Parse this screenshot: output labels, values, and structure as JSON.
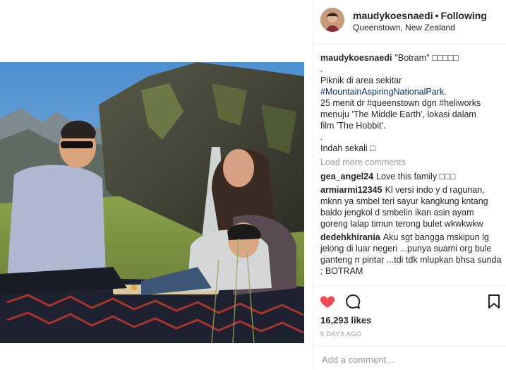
{
  "header": {
    "username": "maudykoesnaedi",
    "separator": "•",
    "follow_status": "Following",
    "location": "Queenstown, New Zealand"
  },
  "caption": {
    "username": "maudykoesnaedi",
    "lines": [
      "\"Botram\" □□□□□",
      ".",
      "Piknik di area sekitar",
      "#MountainAspiringNationalPark.",
      "25 menit dr #queenstown dgn #heliworks",
      "menuju 'The Middle Earth', lokasi dalam",
      "film 'The Hobbit'.",
      ".",
      "Indah sekali □"
    ]
  },
  "load_more": "Load more comments",
  "comments": [
    {
      "username": "gea_angel24",
      "text": "Love this family □□□"
    },
    {
      "username": "armiarmi12345",
      "text": "Kl versi indo y d ragunan, mknn ya smbel teri sayur kangkung kntang baldo jengkol d smbelin ikan asin ayam goreng lalap timun terong bulet wkwkwkw"
    },
    {
      "username": "dedehkhirania",
      "text": "Aku sgt bangga mskipun lg jelong di luar negeri ...punya suami org bule ganteng n pintar ...tdi tdk mlupkan bhsa sunda ; BOTRAM"
    }
  ],
  "actions": {
    "like_icon": "heart-icon",
    "comment_icon": "comment-icon",
    "save_icon": "bookmark-icon"
  },
  "likes": "16,293 likes",
  "time_ago": "5 DAYS AGO",
  "add_comment": {
    "placeholder": "Add a comment..."
  },
  "colors": {
    "like_red": "#ed4956",
    "hashtag_blue": "#003569",
    "muted_gray": "#999999",
    "border": "#efefef"
  }
}
